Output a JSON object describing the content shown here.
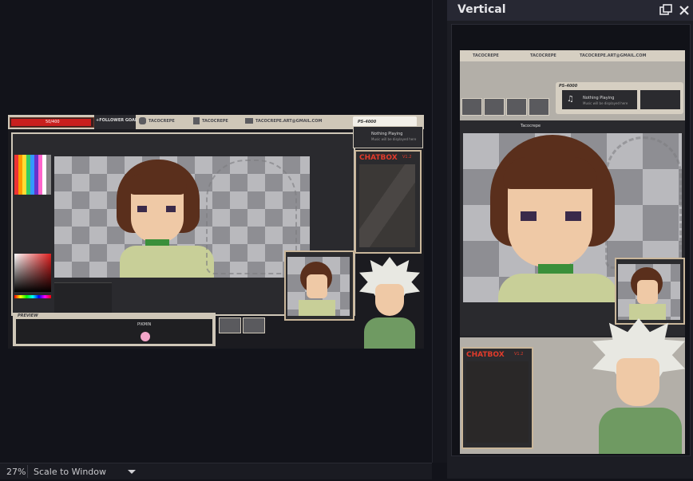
{
  "panel": {
    "title": "Vertical"
  },
  "status": {
    "zoom": "27%",
    "scale_mode": "Scale to Window"
  },
  "scene": {
    "alert_bar": "50/400",
    "follower_goal": "+FOLLOWER GOAL",
    "handles": [
      "TACOCREPE",
      "TACOCREPE",
      "TACOCREPE.ART@GMAIL.COM"
    ],
    "ps_label": "PS-4000",
    "chatbox": "CHATBOX",
    "chatbox_version": "V1.2",
    "music_title": "Nothing Playing",
    "music_sub": "Music will be displayed here",
    "panel_label": "PREVIEW",
    "mini_tab": "Tacocrepe",
    "emote_caption": "PIKMIN"
  },
  "colors": {
    "accent_red": "#e23b2b",
    "frame_beige": "#c9b69a",
    "panel_bg": "#1c1d24",
    "app_bg": "#12131a"
  }
}
